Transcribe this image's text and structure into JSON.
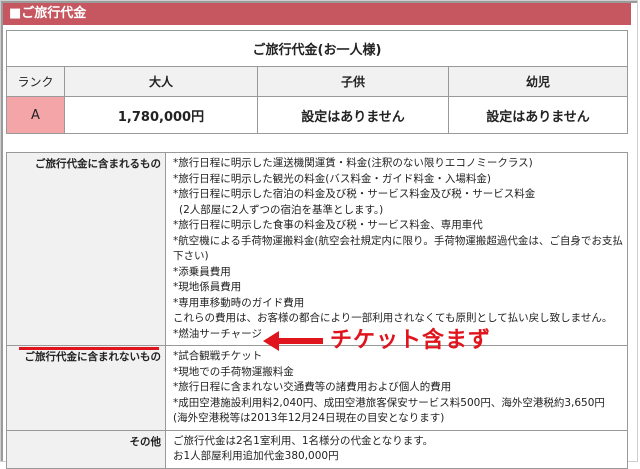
{
  "header": {
    "title": "■ご旅行代金"
  },
  "price_table": {
    "title": "ご旅行代金(お一人様)",
    "columns": [
      "ランク",
      "大人",
      "子供",
      "幼児"
    ],
    "row": {
      "rank": "A",
      "adult": "1,780,000円",
      "child": "設定はありません",
      "infant": "設定はありません"
    }
  },
  "details": {
    "included": {
      "label": "ご旅行代金に含まれるもの",
      "lines": [
        "*旅行日程に明示した運送機関運賃・料金(注釈のない限りエコノミークラス)",
        "*旅行日程に明示した観光の料金(バス料金・ガイド料金・入場料金)",
        "*旅行日程に明示した宿泊の料金及び税・サービス料金及び税・サービス料金",
        "(2人部屋に2人ずつの宿泊を基準とします。)",
        "*旅行日程に明示した食事の料金及び税・サービス料金、専用車代",
        "*航空機による手荷物運搬料金(航空会社規定内に限り。手荷物運搬超過代金は、ご自身でお支払下さい)",
        "*添乗員費用",
        "*現地係員費用",
        "*専用車移動時のガイド費用",
        "これらの費用は、お客様の都合により一部利用されなくても原則として払い戻し致しません。",
        "*燃油サーチャージ"
      ]
    },
    "excluded": {
      "label": "ご旅行代金に含まれないもの",
      "lines": [
        "*試合観戦チケット",
        "*現地での手荷物運搬料金",
        "*旅行日程に含まれない交通費等の諸費用および個人的費用",
        "*成田空港施設利用料2,040円、成田空港旅客保安サービス料500円、海外空港税約3,650円",
        "(海外空港税等は2013年12月24日現在の目安となります)"
      ]
    },
    "other": {
      "label": "その他",
      "lines": [
        "ご旅行代金は2名1室利用、1名様分の代金となります。",
        "お1人部屋利用追加代金380,000円"
      ]
    }
  },
  "annotation": {
    "text": "チケット含まず"
  },
  "colors": {
    "header": "#c6565f",
    "rank_cell": "#f3a5a8",
    "annotation": "#e0141c"
  }
}
